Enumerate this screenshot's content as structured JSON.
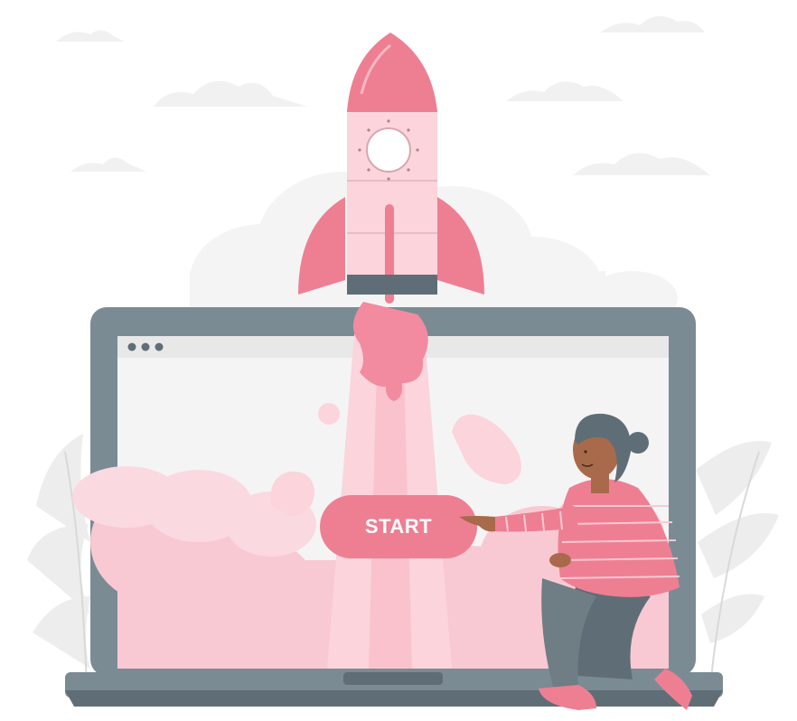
{
  "cta": {
    "label": "START"
  },
  "colors": {
    "accent": "#ee7f93",
    "accent_dark": "#e36a81",
    "accent_light": "#f9c9d3",
    "laptop_frame": "#7b8b94",
    "laptop_frame_dark": "#5f6e76",
    "screen_bg": "#f4f4f4",
    "cloud_bg": "#f0f0f0"
  },
  "icons": [
    "window-dots-icon",
    "rocket-icon",
    "laptop-icon",
    "person-illustration",
    "cloud-decoration",
    "plant-decoration"
  ]
}
